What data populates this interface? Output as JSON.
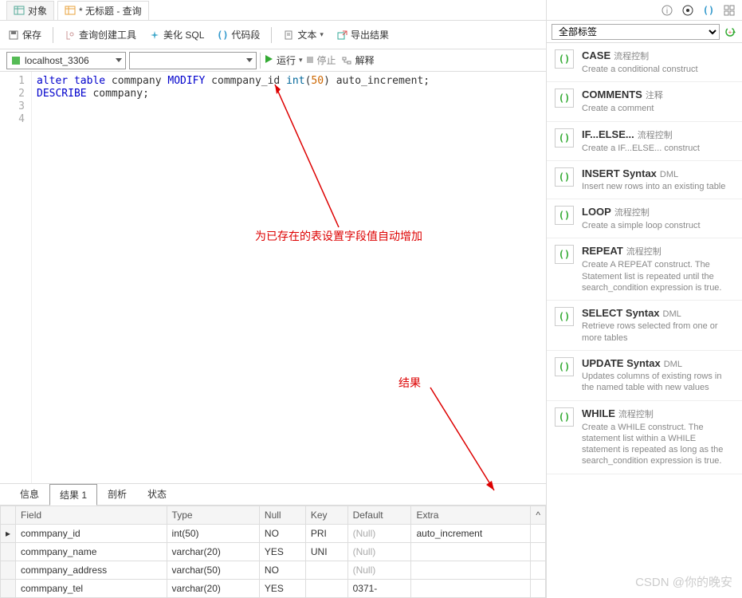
{
  "tabs": {
    "obj": "对象",
    "query": "* 无标题 - 查询"
  },
  "toolbar": {
    "save": "保存",
    "builder": "查询创建工具",
    "beautify": "美化 SQL",
    "snippets": "代码段",
    "text": "文本",
    "export": "导出结果"
  },
  "conn": {
    "host": "localhost_3306",
    "db": "",
    "run": "运行",
    "stop": "停止",
    "explain": "解释"
  },
  "editor": {
    "lines": [
      "1",
      "2",
      "3",
      "4"
    ],
    "l1a": "alter table",
    "l1b": " commpany ",
    "l1c": "MODIFY",
    "l1d": " commpany_id ",
    "l1e": "int",
    "l1f": "(",
    "l1g": "50",
    "l1h": ") auto_increment;",
    "l2a": "DESCRIBE",
    "l2b": " commpany;"
  },
  "annotations": {
    "a1": "为已存在的表设置字段值自动增加",
    "a2": "结果"
  },
  "bottom_tabs": {
    "info": "信息",
    "result1": "结果 1",
    "analyze": "剖析",
    "status": "状态"
  },
  "results": {
    "headers": [
      "Field",
      "Type",
      "Null",
      "Key",
      "Default",
      "Extra"
    ],
    "rows": [
      {
        "field": "commpany_id",
        "type": "int(50)",
        "null": "NO",
        "key": "PRI",
        "default": "(Null)",
        "extra": "auto_increment"
      },
      {
        "field": "commpany_name",
        "type": "varchar(20)",
        "null": "YES",
        "key": "UNI",
        "default": "(Null)",
        "extra": ""
      },
      {
        "field": "commpany_address",
        "type": "varchar(50)",
        "null": "NO",
        "key": "",
        "default": "(Null)",
        "extra": ""
      },
      {
        "field": "commpany_tel",
        "type": "varchar(20)",
        "null": "YES",
        "key": "",
        "default": "0371-",
        "extra": ""
      }
    ]
  },
  "right": {
    "filter": "全部标签",
    "snippets": [
      {
        "title": "CASE",
        "tag": "流程控制",
        "desc": "Create a conditional construct"
      },
      {
        "title": "COMMENTS",
        "tag": "注释",
        "desc": "Create a comment"
      },
      {
        "title": "IF...ELSE...",
        "tag": "流程控制",
        "desc": "Create a IF...ELSE... construct"
      },
      {
        "title": "INSERT Syntax",
        "tag": "DML",
        "desc": "Insert new rows into an existing table"
      },
      {
        "title": "LOOP",
        "tag": "流程控制",
        "desc": "Create a simple loop construct"
      },
      {
        "title": "REPEAT",
        "tag": "流程控制",
        "desc": "Create A REPEAT construct. The Statement list is repeated until the search_condition expression is true."
      },
      {
        "title": "SELECT Syntax",
        "tag": "DML",
        "desc": "Retrieve rows selected from one or more tables"
      },
      {
        "title": "UPDATE Syntax",
        "tag": "DML",
        "desc": "Updates columns of existing rows in the named table with new values"
      },
      {
        "title": "WHILE",
        "tag": "流程控制",
        "desc": "Create a WHILE construct. The statement list within a WHILE statement is repeated as long as the search_condition expression is true."
      }
    ]
  },
  "watermark": "CSDN @你的晚安"
}
